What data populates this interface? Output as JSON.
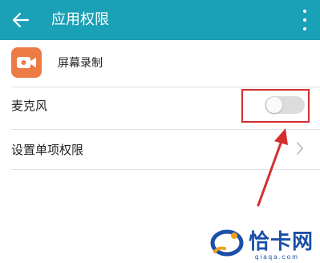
{
  "appbar": {
    "title": "应用权限",
    "back_icon": "arrow-left-icon",
    "more_icon": "more-vertical-icon",
    "color": "#1aa1b5"
  },
  "app": {
    "name": "屏幕录制",
    "icon": "video-camera-icon",
    "icon_color": "#ec7b45"
  },
  "settings": {
    "microphone_label": "麦克风",
    "microphone_enabled": false,
    "single_permission_label": "设置单项权限"
  },
  "annotation": {
    "highlight_color": "#d32f2f"
  },
  "watermark": {
    "name": "恰卡网",
    "url": "qiaqa.com"
  }
}
